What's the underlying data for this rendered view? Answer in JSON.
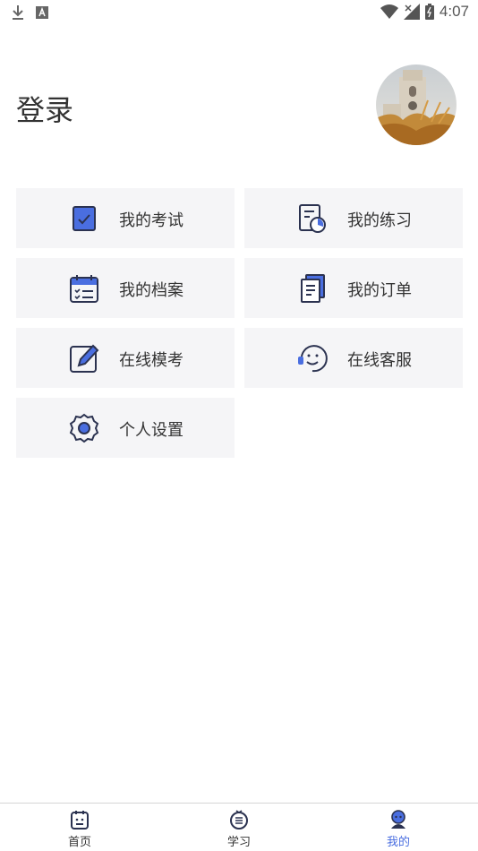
{
  "status_bar": {
    "time": "4:07"
  },
  "header": {
    "title": "登录"
  },
  "menu": [
    {
      "label": "我的考试",
      "icon": "exam-icon"
    },
    {
      "label": "我的练习",
      "icon": "practice-icon"
    },
    {
      "label": "我的档案",
      "icon": "calendar-icon"
    },
    {
      "label": "我的订单",
      "icon": "order-icon"
    },
    {
      "label": "在线模考",
      "icon": "edit-icon"
    },
    {
      "label": "在线客服",
      "icon": "customer-service-icon"
    },
    {
      "label": "个人设置",
      "icon": "settings-icon"
    }
  ],
  "tabbar": {
    "tabs": [
      {
        "label": "首页",
        "icon": "home-icon"
      },
      {
        "label": "学习",
        "icon": "study-icon"
      },
      {
        "label": "我的",
        "icon": "profile-icon"
      }
    ],
    "active": "我的"
  },
  "colors": {
    "accent": "#4a6ee0",
    "tile_bg": "#f5f5f7",
    "icon_dark": "#2b3250"
  }
}
